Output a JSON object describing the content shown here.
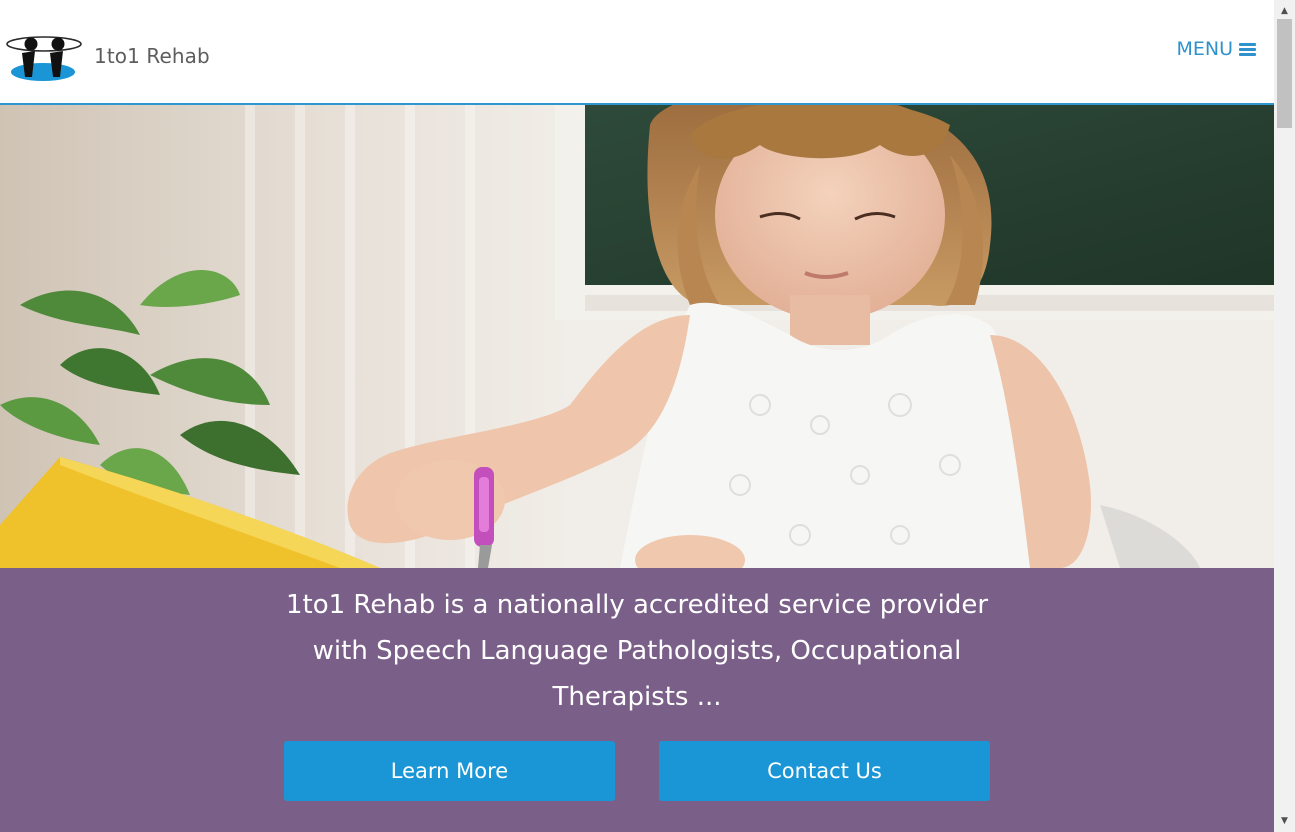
{
  "header": {
    "brand": "1to1 Rehab",
    "menu_label": "MENU",
    "menu_icon": "hamburger-icon",
    "logo_icon": "1to1-rehab-logo",
    "border_color": "#2f97cf"
  },
  "hero": {
    "image": "girl-cutting-paper-with-scissors"
  },
  "band": {
    "background": "#7a5f89",
    "headline_line1": "1to1 Rehab is a nationally accredited service provider",
    "headline_line2": "with Speech Language Pathologists, Occupational",
    "headline_line3": "Therapists ...",
    "learn_more_label": "Learn More",
    "contact_us_label": "Contact Us",
    "button_color": "#1a96d6"
  },
  "scrollbar": {
    "up_icon": "arrow-up-icon",
    "down_icon": "arrow-down-icon"
  }
}
